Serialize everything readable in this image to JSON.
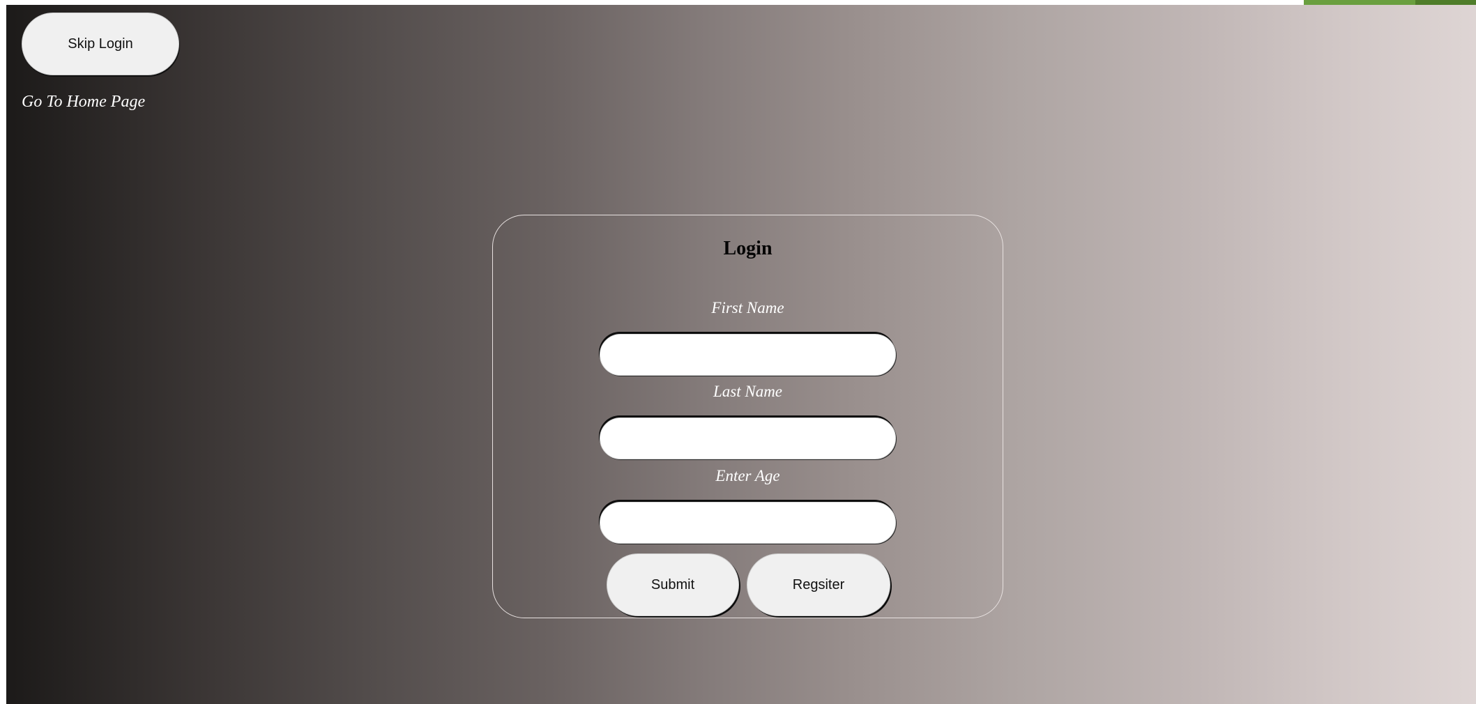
{
  "top_bar": {
    "skip_login_label": "Skip Login",
    "home_link_label": "Go To Home Page"
  },
  "login_form": {
    "title": "Login",
    "fields": [
      {
        "label": "First Name",
        "value": "",
        "placeholder": ""
      },
      {
        "label": "Last Name",
        "value": "",
        "placeholder": ""
      },
      {
        "label": "Enter Age",
        "value": "",
        "placeholder": ""
      }
    ],
    "submit_label": "Submit",
    "register_label": "Regsiter"
  },
  "colors": {
    "gradient_left": "#1c1a19",
    "gradient_right": "#ded5d4",
    "button_fill": "#f0f0f0",
    "label_text": "#ffffff",
    "title_text": "#050505",
    "corner_accent": "#6a9f3f"
  }
}
